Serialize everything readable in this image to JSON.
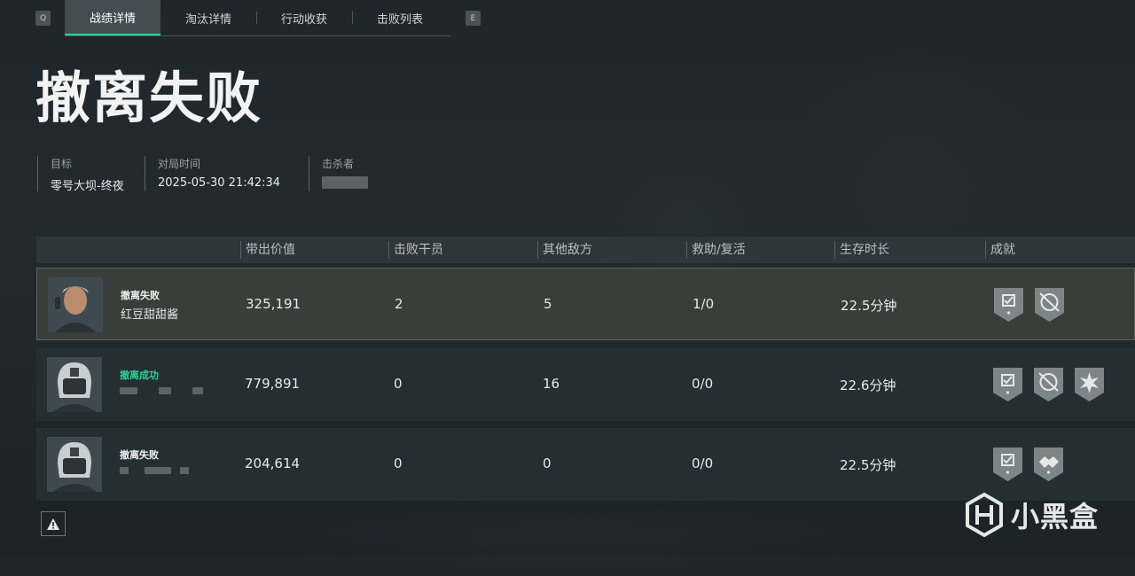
{
  "tabs": {
    "left_key": "Q",
    "right_key": "E",
    "items": [
      "战绩详情",
      "淘汰详情",
      "行动收获",
      "击败列表"
    ],
    "active": 0
  },
  "title": "撤离失败",
  "meta": {
    "target_label": "目标",
    "target_value": "零号大坝-终夜",
    "time_label": "对局时间",
    "time_value": "2025-05-30 21:42:34",
    "killer_label": "击杀者"
  },
  "table": {
    "headers": [
      "带出价值",
      "击败干员",
      "其他敌方",
      "救助/复活",
      "生存时长",
      "成就"
    ],
    "rows": [
      {
        "status": "撤离失败",
        "status_type": "fail",
        "name": "红豆甜甜酱",
        "value": "325,191",
        "kills": "2",
        "other": "5",
        "assist": "1/0",
        "survive": "22.5分钟",
        "badges": [
          "medal-icon",
          "crosshair-icon"
        ]
      },
      {
        "status": "撤离成功",
        "status_type": "success",
        "name": "",
        "value": "779,891",
        "kills": "0",
        "other": "16",
        "assist": "0/0",
        "survive": "22.6分钟",
        "badges": [
          "medal-icon",
          "crosshair-icon",
          "burst-icon"
        ]
      },
      {
        "status": "撤离失败",
        "status_type": "fail",
        "name": "",
        "value": "204,614",
        "kills": "0",
        "other": "0",
        "assist": "0/0",
        "survive": "22.5分钟",
        "badges": [
          "medal-icon",
          "handshake-icon"
        ]
      }
    ]
  },
  "watermark": "小黑盒",
  "colors": {
    "accent": "#27d39a",
    "success": "#28d296"
  }
}
